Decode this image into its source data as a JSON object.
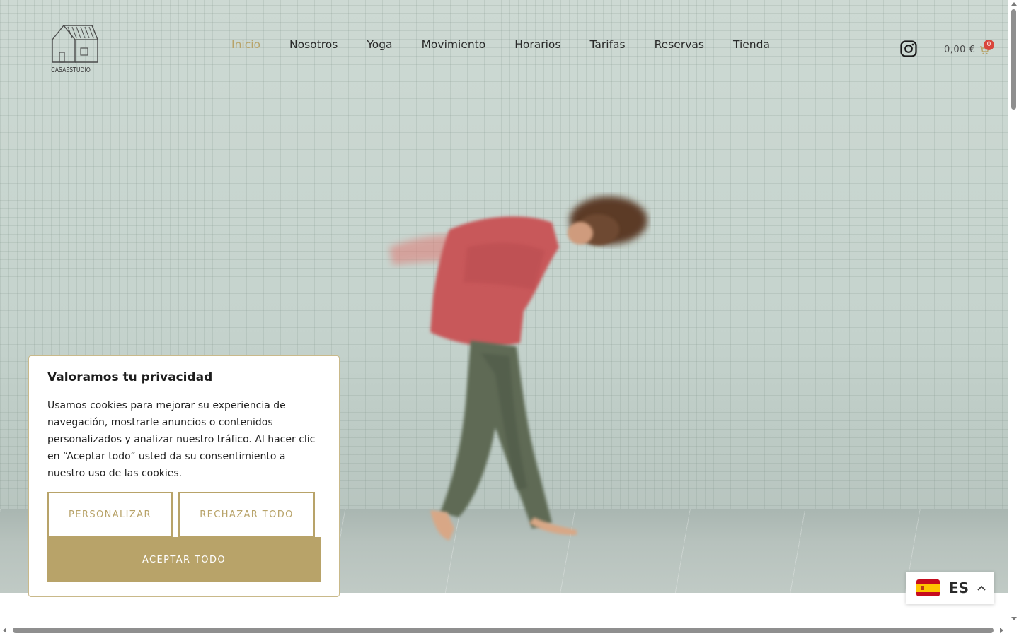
{
  "brand": {
    "logo_text": "CASAESTUDIO",
    "logo_icon": "house-outline-icon",
    "accent_color": "#b8a369"
  },
  "nav": {
    "items": [
      {
        "label": "Inicio",
        "active": true
      },
      {
        "label": "Nosotros",
        "active": false
      },
      {
        "label": "Yoga",
        "active": false
      },
      {
        "label": "Movimiento",
        "active": false
      },
      {
        "label": "Horarios",
        "active": false
      },
      {
        "label": "Tarifas",
        "active": false
      },
      {
        "label": "Reservas",
        "active": false
      },
      {
        "label": "Tienda",
        "active": false
      }
    ]
  },
  "header_actions": {
    "instagram_icon": "instagram-icon",
    "cart_amount": "0,00 €",
    "cart_icon": "shopping-cart-icon",
    "cart_count": "0"
  },
  "hero": {
    "image": "person-dancing-against-tiled-wall"
  },
  "cookie_banner": {
    "title": "Valoramos tu privacidad",
    "text": "Usamos cookies para mejorar su experiencia de navegación, mostrarle anuncios o contenidos personalizados y analizar nuestro tráfico. Al hacer clic en “Aceptar todo” usted da su consentimiento a nuestro uso de las cookies.",
    "customize_label": "PERSONALIZAR",
    "reject_label": "RECHAZAR TODO",
    "accept_label": "ACEPTAR TODO"
  },
  "language_switcher": {
    "code": "ES",
    "flag": "spain-flag-icon",
    "caret": "chevron-up-icon"
  }
}
